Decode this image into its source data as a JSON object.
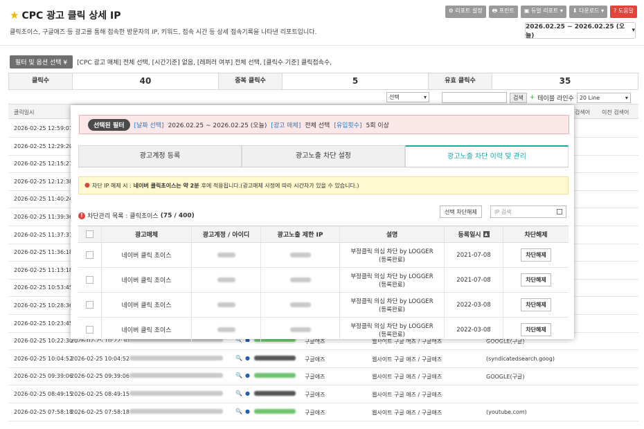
{
  "header": {
    "title": "CPC 광고 클릭 상세 IP",
    "subtitle": "클릭초이스, 구글애즈 등 광고를 통해 접속한 방문자의 IP, 키워드, 접속 시간 등 상세 접속기록을 나타낸 리포트입니다.",
    "buttons": [
      "리포트 설정",
      "프린트",
      "듀얼 리포트",
      "다운로드",
      "도움말"
    ],
    "date_range": "2026.02.25 ~ 2026.02.25 (오늘)"
  },
  "filter": {
    "button": "필터 및 옵션 선택",
    "summary": "[CPC 광고 매체] 전체 선택, [시간기준] 없음, [레퍼러 여부] 전체 선택, [클릭수 기준] 클릭접속수,"
  },
  "stats": [
    {
      "label": "클릭수",
      "value": "40"
    },
    {
      "label": "중복 클릭수",
      "value": "5"
    },
    {
      "label": "유효 클릭수",
      "value": "35"
    }
  ],
  "controls": {
    "select": "선택",
    "search_btn": "검색",
    "lines_label": "테이블 라인수",
    "lines_value": "20 Line"
  },
  "table": {
    "headers": [
      "클릭일시",
      "검색어",
      "이전 검색어"
    ],
    "rows": [
      {
        "t1": "2026-02-25 12:59:01"
      },
      {
        "t1": "2026-02-25 12:29:20"
      },
      {
        "t1": "2026-02-25 12:15:27"
      },
      {
        "t1": "2026-02-25 12:12:38"
      },
      {
        "t1": "2026-02-25 11:40:24"
      },
      {
        "t1": "2026-02-25 11:39:36"
      },
      {
        "t1": "2026-02-25 11:37:31"
      },
      {
        "t1": "2026-02-25 11:36:18"
      },
      {
        "t1": "2026-02-25 11:13:18"
      },
      {
        "t1": "2026-02-25 10:53:45"
      },
      {
        "t1": "2026-02-25 10:28:36"
      },
      {
        "t1": "2026-02-25 10:23:45"
      },
      {
        "t1": "2026-02-25 10:22:30",
        "t2": "2026-02-25 10:22:30",
        "media": "구글애즈",
        "site": "웹사이트 구글 애즈 / 구글애즈",
        "ref": "GOOGLE(구글)"
      },
      {
        "t1": "2026-02-25 10:04:52",
        "t2": "2026-02-25 10:04:52",
        "media": "구글애즈",
        "site": "웹사이트 구글 애즈 / 구글애즈",
        "ref": "(syndicatedsearch.goog)"
      },
      {
        "t1": "2026-02-25 09:39:06",
        "t2": "2026-02-25 09:39:06",
        "media": "구글애즈",
        "site": "웹사이트 구글 애즈 / 구글애즈",
        "ref": "GOOGLE(구글)"
      },
      {
        "t1": "2026-02-25 08:49:15",
        "t2": "2026-02-25 08:49:15",
        "media": "구글애즈",
        "site": "웹사이트 구글 애즈 / 구글애즈",
        "ref": ""
      },
      {
        "t1": "2026-02-25 07:58:18",
        "t2": "2026-02-25 07:58:18",
        "media": "구글애즈",
        "site": "웹사이트 구글 애즈 / 구글애즈",
        "ref": "(youtube.com)"
      }
    ]
  },
  "modal": {
    "selected_filter_label": "선택된 필터",
    "sf_date_key": "[날짜 선택]",
    "sf_date_val": "2026.02.25 ~ 2026.02.25 (오늘)",
    "sf_media_key": "[광고 매체]",
    "sf_media_val": "전체 선택",
    "sf_count_key": "[유입횟수]",
    "sf_count_val": "5회 이상",
    "tabs": [
      "광고계정 등록",
      "광고노출 차단 설정",
      "광고노출 차단 이력 및 관리"
    ],
    "warn_pre": "차단 IP 해제 시 :",
    "warn_bold": "네이버 클릭초이스는 약 2분",
    "warn_post": "후에 적용됩니다.(광고매체 사정에 따라 시간차가 있을 수 있습니다.)",
    "list_label": "차단관리 목록 : 클릭초이스",
    "list_count": "(75 / 400)",
    "unblock_selected": "선택 차단해제",
    "ip_search_placeholder": "IP 검색",
    "headers": [
      "광고매체",
      "광고계정 / 아이디",
      "광고노출 제한 IP",
      "설명",
      "등록일시",
      "차단해제"
    ],
    "rows": [
      {
        "media": "네이버 클릭 초이스",
        "desc1": "부정클릭 의심 차단 by LOGGER",
        "desc2": "(등록완료)",
        "date": "2021-07-08",
        "btn": "차단해제"
      },
      {
        "media": "네이버 클릭 초이스",
        "desc1": "부정클릭 의심 차단 by LOGGER",
        "desc2": "(등록완료)",
        "date": "2021-07-08",
        "btn": "차단해제"
      },
      {
        "media": "네이버 클릭 초이스",
        "desc1": "부정클릭 의심 차단 by LOGGER",
        "desc2": "(등록완료)",
        "date": "2022-03-08",
        "btn": "차단해제"
      },
      {
        "media": "네이버 클릭 초이스",
        "desc1": "부정클릭 의심 차단 by LOGGER",
        "desc2": "(등록완료)",
        "date": "2022-03-08",
        "btn": "차단해제"
      }
    ]
  }
}
